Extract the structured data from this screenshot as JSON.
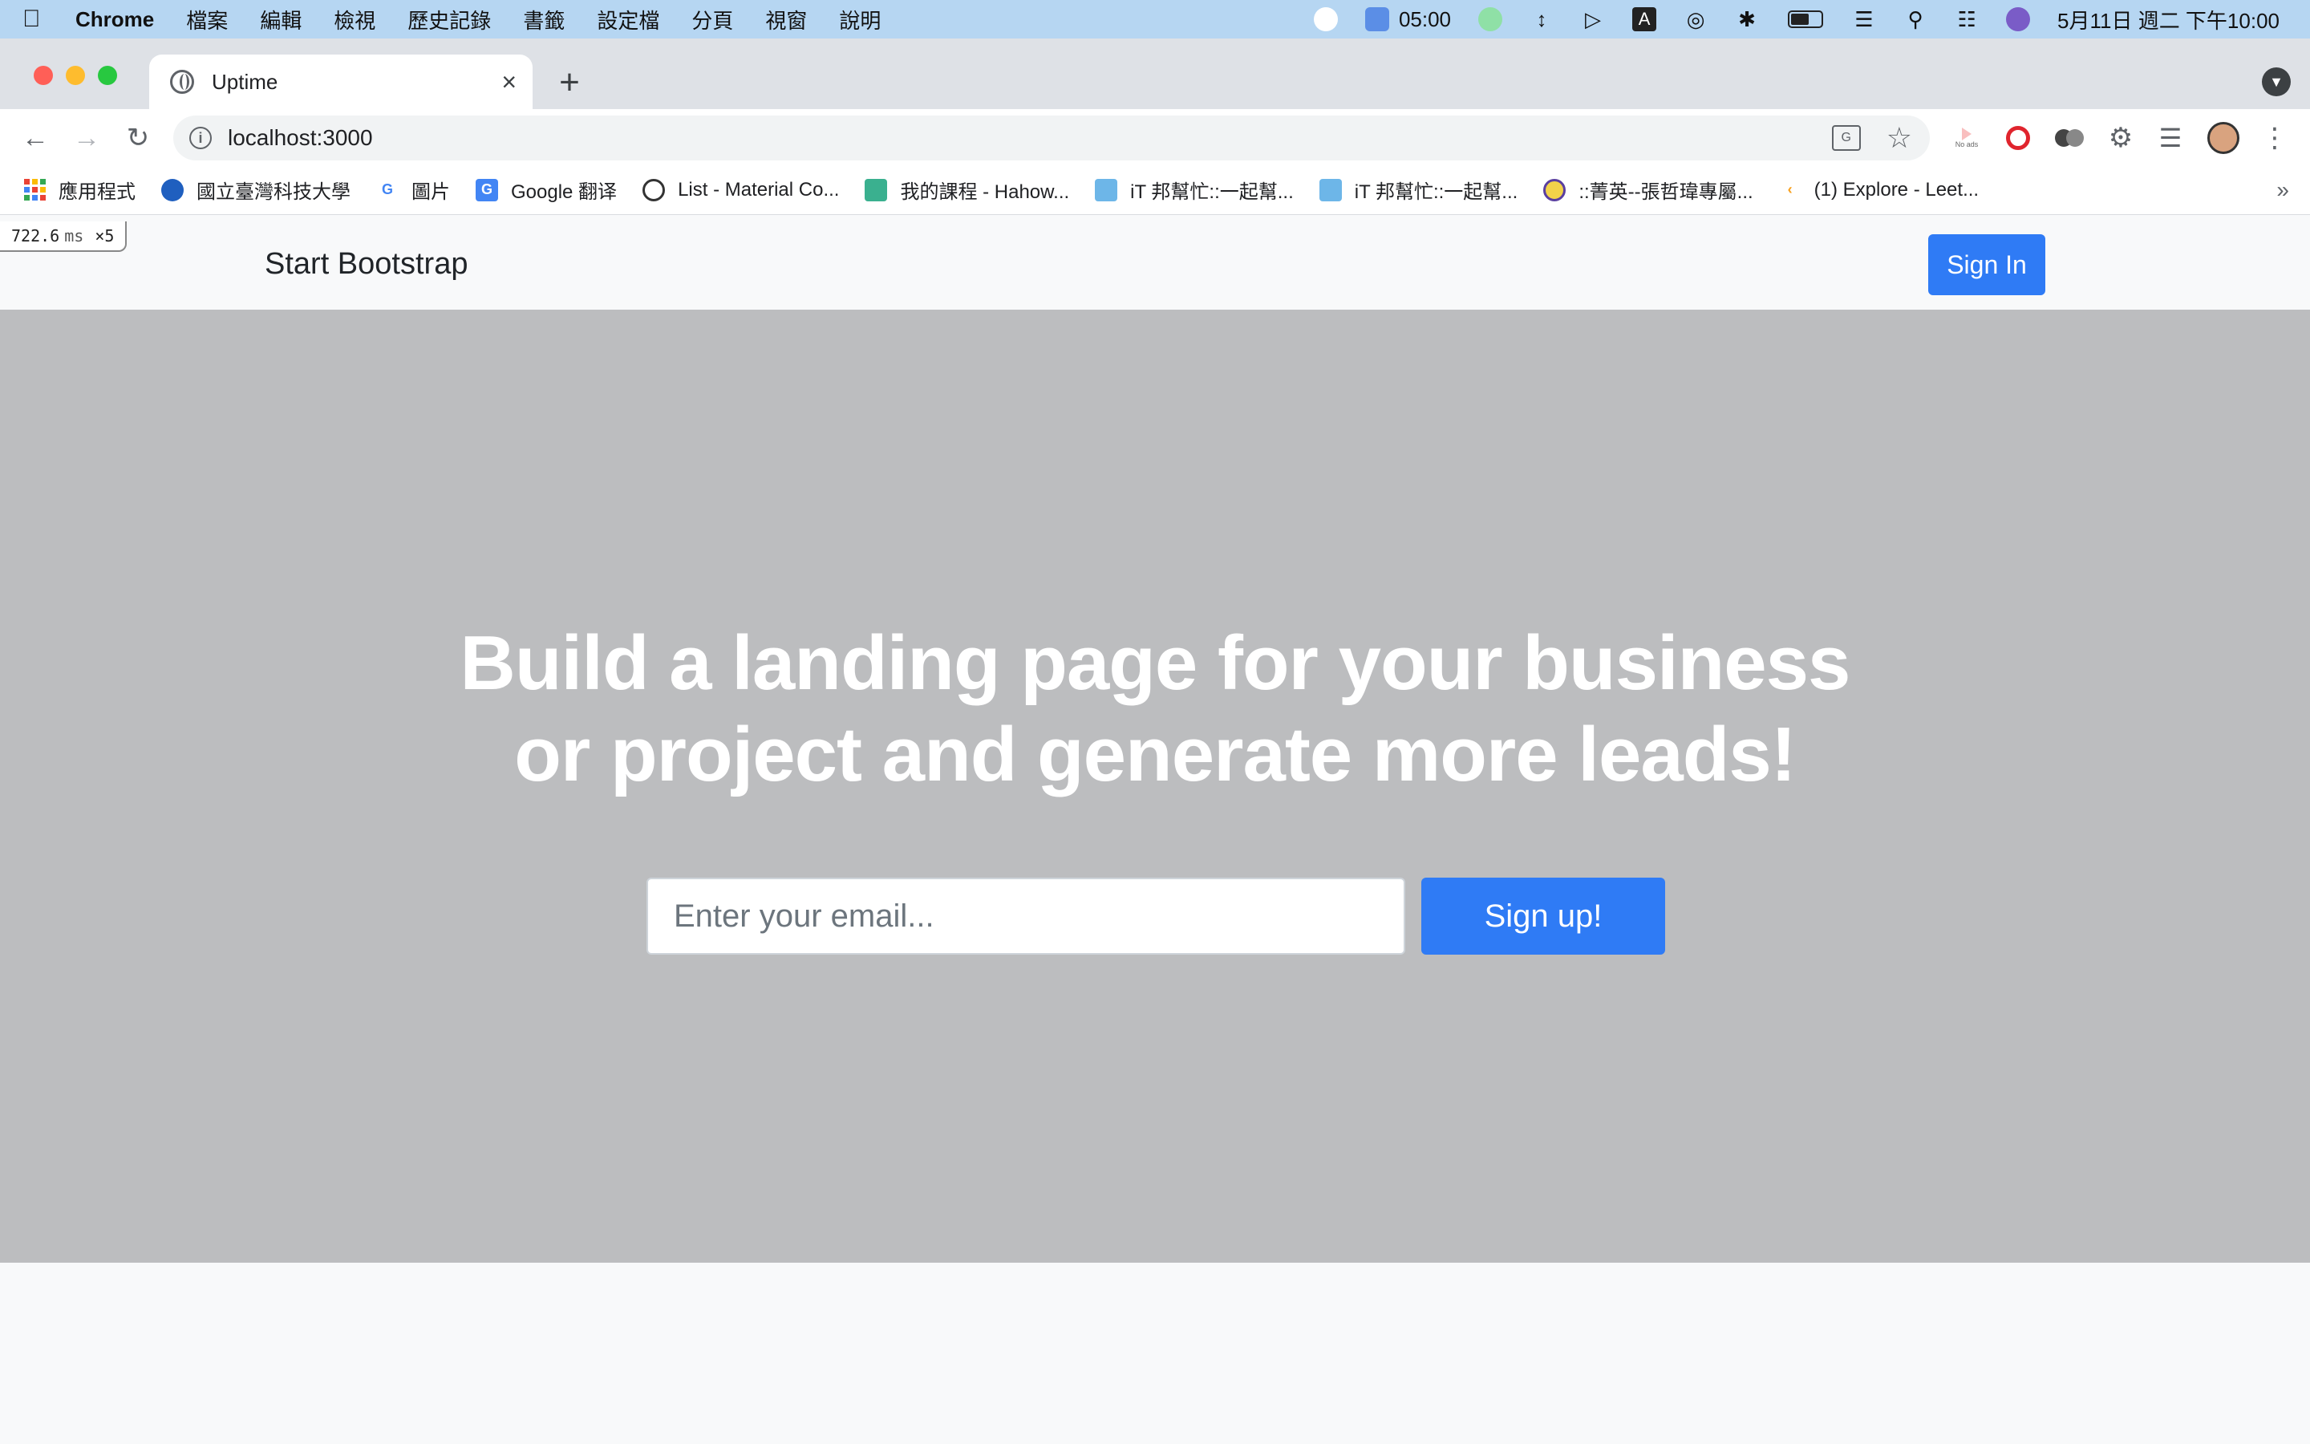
{
  "menubar": {
    "app_name": "Chrome",
    "items": [
      "檔案",
      "編輯",
      "檢視",
      "歷史記錄",
      "書籤",
      "設定檔",
      "分頁",
      "視窗",
      "說明"
    ],
    "timer": "05:00",
    "datetime": "5月11日 週二 下午10:00"
  },
  "browser": {
    "tab_title": "Uptime",
    "url": "localhost:3000",
    "noads_label": "No ads",
    "bookmarks": [
      "應用程式",
      "國立臺灣科技大學",
      "圖片",
      "Google 翻译",
      "List - Material Co...",
      "我的課程 - Hahow...",
      "iT 邦幫忙::一起幫...",
      "iT 邦幫忙::一起幫...",
      "::菁英--張哲瑋專屬...",
      "(1) Explore - Leet..."
    ],
    "more_label": "»"
  },
  "perf": {
    "value": "722.6",
    "unit": "ms",
    "multiplier": "×5"
  },
  "page": {
    "brand": "Start Bootstrap",
    "signin_label": "Sign In",
    "headline_line1": "Build a landing page for your business",
    "headline_line2": "or project and generate more leads!",
    "email_placeholder": "Enter your email...",
    "signup_label": "Sign up!"
  },
  "colors": {
    "primary": "#2f7bf5",
    "masthead_bg": "#bcbdbf",
    "navbar_bg": "#f8f9fa",
    "menubar_bg": "#b6d6f2"
  }
}
